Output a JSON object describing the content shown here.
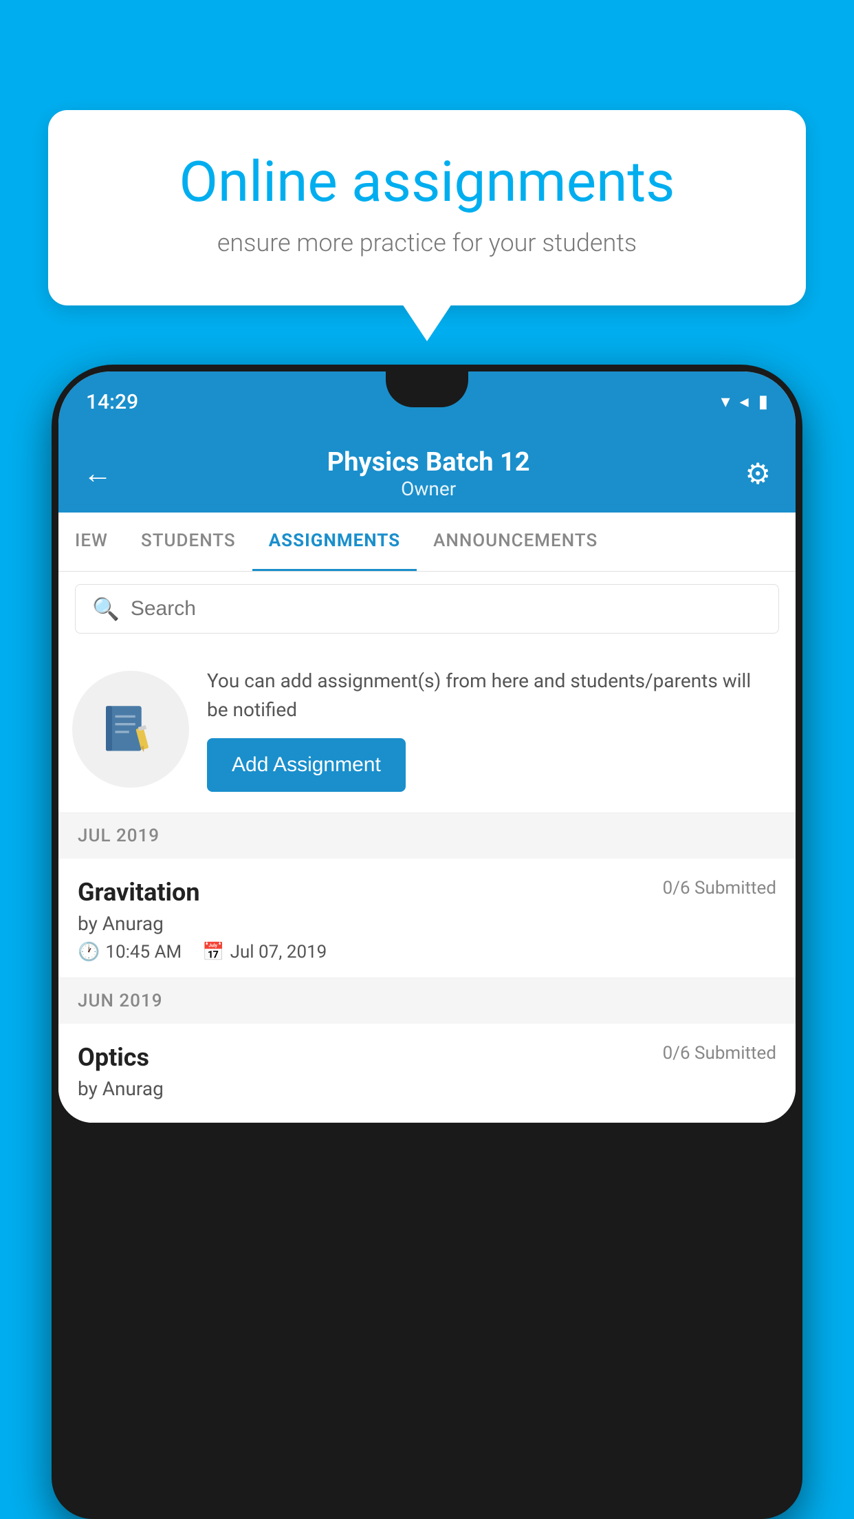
{
  "background_color": "#00AEEF",
  "speech_bubble": {
    "title": "Online assignments",
    "subtitle": "ensure more practice for your students"
  },
  "phone": {
    "status_bar": {
      "time": "14:29",
      "icons": [
        "wifi",
        "signal",
        "battery"
      ]
    },
    "header": {
      "batch_name": "Physics Batch 12",
      "owner_label": "Owner",
      "back_label": "←",
      "settings_label": "⚙"
    },
    "tabs": [
      {
        "label": "IEW",
        "active": false
      },
      {
        "label": "STUDENTS",
        "active": false
      },
      {
        "label": "ASSIGNMENTS",
        "active": true
      },
      {
        "label": "ANNOUNCEMENTS",
        "active": false
      }
    ],
    "search": {
      "placeholder": "Search"
    },
    "promo": {
      "description": "You can add assignment(s) from here and students/parents will be notified",
      "button_label": "Add Assignment"
    },
    "sections": [
      {
        "month_label": "JUL 2019",
        "assignments": [
          {
            "title": "Gravitation",
            "submitted": "0/6 Submitted",
            "by": "by Anurag",
            "time": "10:45 AM",
            "date": "Jul 07, 2019"
          }
        ]
      },
      {
        "month_label": "JUN 2019",
        "assignments": [
          {
            "title": "Optics",
            "submitted": "0/6 Submitted",
            "by": "by Anurag",
            "time": "",
            "date": ""
          }
        ]
      }
    ]
  }
}
